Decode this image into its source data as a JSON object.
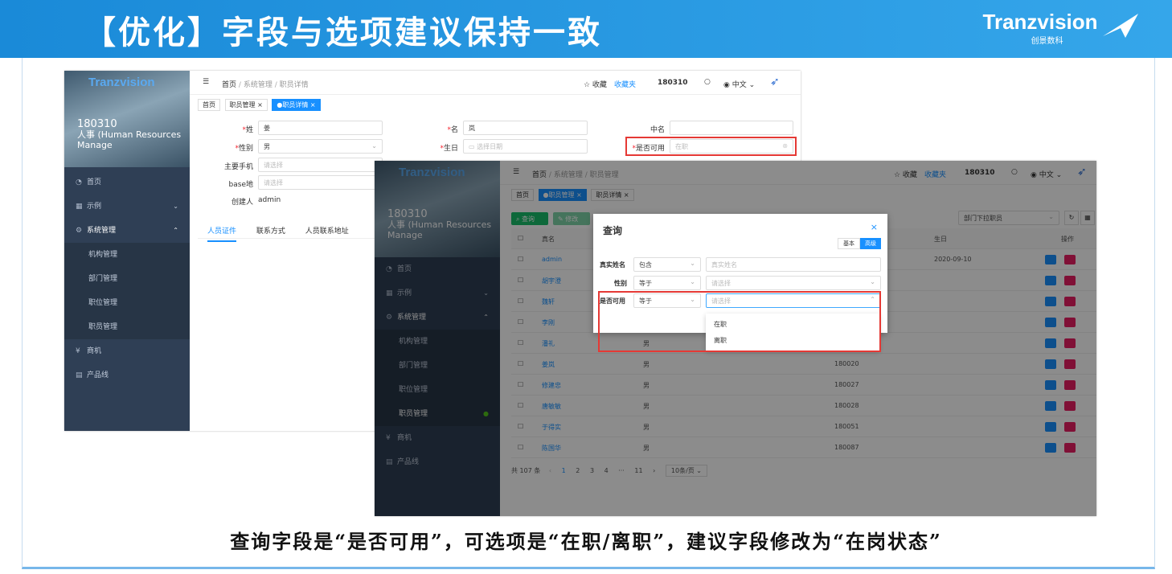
{
  "banner": {
    "title": "【优化】字段与选项建议保持一致",
    "brand": "Tranzvision",
    "brand_sub": "创景数科"
  },
  "caption": "查询字段是“是否可用”，可选项是“在职/离职”，建议字段修改为“在岗状态”",
  "shot1": {
    "logo": "Tranzvision",
    "user": "180310",
    "role": "人事 (Human Resources Manage",
    "menu": {
      "home": "首页",
      "example": "示例",
      "sys": "系统管理",
      "org": "机构管理",
      "dept": "部门管理",
      "pos": "职位管理",
      "staff": "职员管理",
      "biz": "商机",
      "product": "产品线"
    },
    "breadcrumb": {
      "home": "首页",
      "sep1": "/",
      "sys": "系统管理",
      "sep2": "/",
      "page": "职员详情"
    },
    "top": {
      "fav": "☆ 收藏",
      "favlist": "收藏夹",
      "user": "180310",
      "lang": "中文"
    },
    "tags": {
      "home": "首页",
      "staff": "职员管理 ×",
      "detail": "●职员详情 ×"
    },
    "form": {
      "surname_label": "姓",
      "surname": "姜",
      "name_label": "名",
      "name": "岚",
      "cname_label": "中名",
      "gender_label": "性别",
      "gender": "男",
      "birth_label": "生日",
      "birth_ph": "选择日期",
      "avail_label": "是否可用",
      "avail_ph": "在职",
      "phone_label": "主要手机",
      "phone_ph": "请选择",
      "base_label": "base地",
      "base_ph": "请选择",
      "creator_label": "创建人",
      "creator": "admin"
    },
    "tabs": {
      "cert": "人员证件",
      "contact": "联系方式",
      "addr": "人员联系地址"
    }
  },
  "shot2": {
    "logo": "Tranzvision",
    "user": "180310",
    "role": "人事 (Human Resources Manage",
    "menu": {
      "home": "首页",
      "example": "示例",
      "sys": "系统管理",
      "org": "机构管理",
      "dept": "部门管理",
      "pos": "职位管理",
      "staff": "职员管理",
      "biz": "商机",
      "product": "产品线"
    },
    "breadcrumb": {
      "home": "首页",
      "sep1": "/",
      "sys": "系统管理",
      "sep2": "/",
      "page": "职员管理"
    },
    "top": {
      "fav": "☆ 收藏",
      "favlist": "收藏夹",
      "user": "180310",
      "lang": "中文"
    },
    "tags": {
      "home": "首页",
      "staff": "●职员管理 ×",
      "detail": "职员详情 ×"
    },
    "buttons": {
      "query": "查询",
      "edit": "修改"
    },
    "dept_filter": "部门下拉职员",
    "columns": {
      "name": "真名",
      "birth": "生日",
      "op": "操作"
    },
    "rows": [
      {
        "name": "admin",
        "gender": "",
        "code": "",
        "birth": "2020-09-10"
      },
      {
        "name": "胡宇澄",
        "gender": "",
        "code": "",
        "birth": ""
      },
      {
        "name": "魏轩",
        "gender": "",
        "code": "",
        "birth": ""
      },
      {
        "name": "李刚",
        "gender": "",
        "code": "",
        "birth": ""
      },
      {
        "name": "潘礼",
        "gender": "男",
        "code": "",
        "birth": ""
      },
      {
        "name": "姜岚",
        "gender": "男",
        "code": "180020",
        "birth": ""
      },
      {
        "name": "修建忠",
        "gender": "男",
        "code": "180027",
        "birth": ""
      },
      {
        "name": "唐敏敏",
        "gender": "男",
        "code": "180028",
        "birth": ""
      },
      {
        "name": "于得实",
        "gender": "男",
        "code": "180051",
        "birth": ""
      },
      {
        "name": "陈国华",
        "gender": "男",
        "code": "180087",
        "birth": ""
      }
    ],
    "pager": {
      "total": "共 107 条",
      "p1": "1",
      "p2": "2",
      "p3": "3",
      "p4": "4",
      "dots": "···",
      "p11": "11",
      "size": "10条/页"
    },
    "modal": {
      "title": "查询",
      "close": "×",
      "basic": "基本",
      "advanced": "高级",
      "f1_label": "真实姓名",
      "f1_op": "包含",
      "f1_ph": "真实姓名",
      "f2_label": "性别",
      "f2_op": "等于",
      "f2_ph": "请选择",
      "f3_label": "是否可用",
      "f3_op": "等于",
      "f3_ph": "请选择",
      "opt1": "在职",
      "opt2": "离职"
    }
  }
}
